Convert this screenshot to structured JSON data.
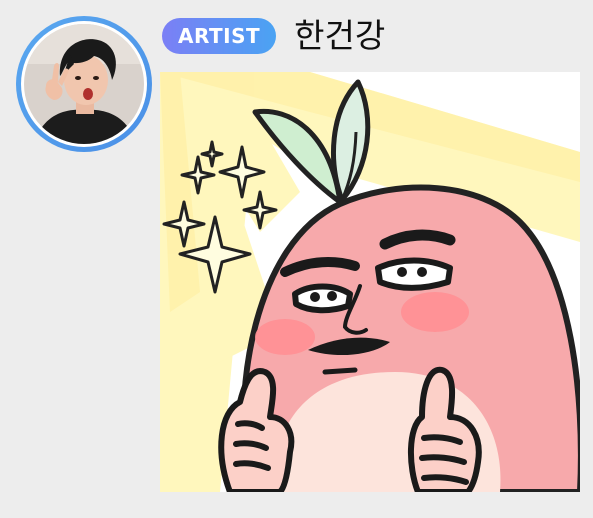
{
  "message": {
    "badge_label": "ARTIST",
    "author_name": "한건강",
    "sticker_description_name": "peach-character-sticker"
  },
  "colors": {
    "background": "#ededed",
    "avatar_ring": "#4a8fe6",
    "badge_gradient_start": "#7b7ff5",
    "badge_gradient_end": "#4aa3f3",
    "sticker_rays": "#fff6b0",
    "character_body": "#f7a8a8",
    "leaf_green": "#cfeed0"
  }
}
